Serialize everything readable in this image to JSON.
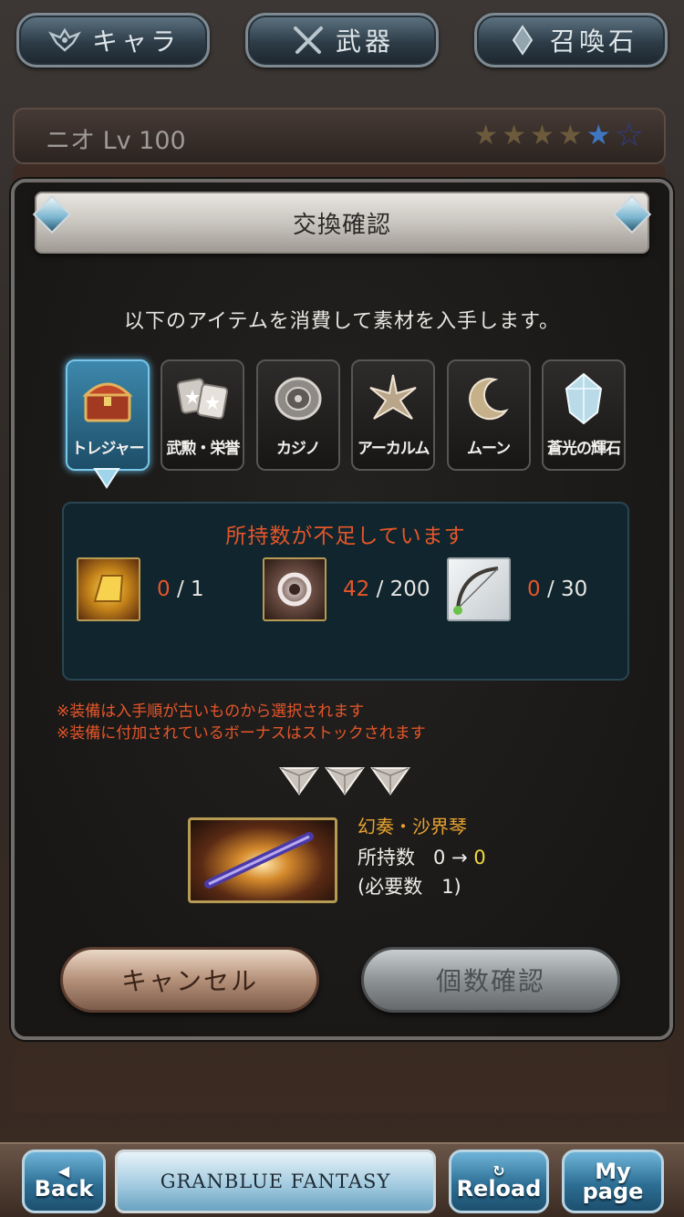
{
  "top_tabs": [
    {
      "label": "キャラ",
      "icon": "emblem-icon"
    },
    {
      "label": "武器",
      "icon": "crossed-swords-icon"
    },
    {
      "label": "召喚石",
      "icon": "crystal-icon"
    }
  ],
  "character": {
    "name_level": "ニオ Lv 100",
    "stars_filled": 4,
    "stars_blue": 1,
    "stars_outline": 1
  },
  "dialog": {
    "title": "交換確認",
    "description": "以下のアイテムを消費して素材を入手します。",
    "categories": [
      {
        "label": "トレジャー",
        "icon": "treasure-chest-icon",
        "active": true
      },
      {
        "label": "武勲・栄誉",
        "icon": "medal-icon",
        "active": false
      },
      {
        "label": "カジノ",
        "icon": "casino-chip-icon",
        "active": false
      },
      {
        "label": "アーカルム",
        "icon": "arcarum-star-icon",
        "active": false
      },
      {
        "label": "ムーン",
        "icon": "moon-icon",
        "active": false
      },
      {
        "label": "蒼光の輝石",
        "icon": "blue-crystal-icon",
        "active": false
      }
    ],
    "shortage": {
      "title": "所持数が不足しています",
      "items": [
        {
          "icon": "gold-bar-icon",
          "current": "0",
          "required": "1"
        },
        {
          "icon": "ring-item-icon",
          "current": "42",
          "required": "200"
        },
        {
          "icon": "bow-weapon-icon",
          "current": "0",
          "required": "30"
        }
      ]
    },
    "notes": [
      "※装備は入手順が古いものから選択されます",
      "※装備に付加されているボーナスはストックされます"
    ],
    "result": {
      "name": "幻奏・沙界琴",
      "own_label": "所持数",
      "own_from": "0",
      "arrow": "→",
      "own_to": "0",
      "need_text": "(必要数　1)"
    },
    "buttons": {
      "cancel": "キャンセル",
      "confirm": "個数確認"
    }
  },
  "footer": {
    "back": "Back",
    "logo": "GRANBLUE FANTASY",
    "reload": "Reload",
    "mypage_1": "My",
    "mypage_2": "page"
  },
  "colors": {
    "warning": "#e6562a",
    "accent_gold": "#e9a430",
    "active_tab": "#3d88ac"
  }
}
